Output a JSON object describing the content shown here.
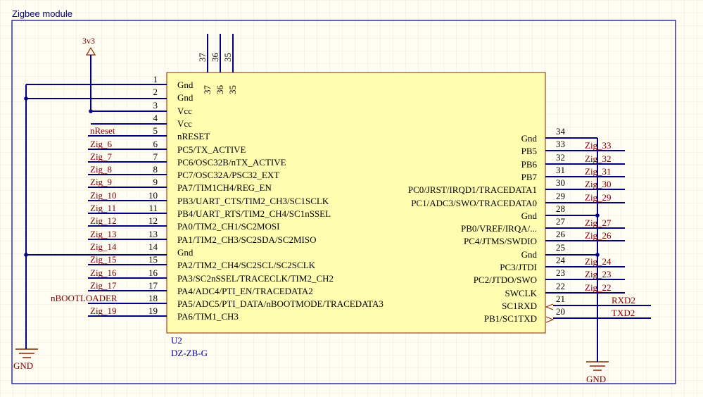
{
  "sheet": {
    "title": "Zigbee module",
    "colors": {
      "background": "#fffcf2",
      "grid": "#ebe8df",
      "border": "#000080",
      "wire": "#000080",
      "body_fill": "#fffeb0",
      "body_stroke": "#8b2500",
      "net_label": "#800000",
      "pin_text": "#000000",
      "designator": "#0000a0"
    }
  },
  "power": {
    "vcc_label": "3v3",
    "gnd_left_label": "GND",
    "gnd_right_label": "GND"
  },
  "component": {
    "designator": "U2",
    "part": "DZ-ZB-G",
    "top_pins": [
      {
        "number": "37",
        "name": "37"
      },
      {
        "number": "36",
        "name": "36"
      },
      {
        "number": "35",
        "name": "35"
      }
    ],
    "left_pins": [
      {
        "number": "1",
        "name": "Gnd",
        "net": ""
      },
      {
        "number": "2",
        "name": "Gnd",
        "net": ""
      },
      {
        "number": "3",
        "name": "Vcc",
        "net": ""
      },
      {
        "number": "4",
        "name": "Vcc",
        "net": ""
      },
      {
        "number": "5",
        "name": "nRESET",
        "net": "nReset"
      },
      {
        "number": "6",
        "name": "PC5/TX_ACTIVE",
        "net": "Zig_6"
      },
      {
        "number": "7",
        "name": "PC6/OSC32B/nTX_ACTIVE",
        "net": "Zig_7"
      },
      {
        "number": "8",
        "name": "PC7/OSC32A/PSC32_EXT",
        "net": "Zig_8"
      },
      {
        "number": "9",
        "name": "PA7/TIM1CH4/REG_EN",
        "net": "Zig_9"
      },
      {
        "number": "10",
        "name": "PB3/UART_CTS/TIM2_CH3/SC1SCLK",
        "net": "Zig_10"
      },
      {
        "number": "11",
        "name": "PB4/UART_RTS/TIM2_CH4/SC1nSSEL",
        "net": "Zig_11"
      },
      {
        "number": "12",
        "name": "PA0/TIM2_CH1/SC2MOSI",
        "net": "Zig_12"
      },
      {
        "number": "13",
        "name": "PA1/TIM2_CH3/SC2SDA/SC2MISO",
        "net": "Zig_13"
      },
      {
        "number": "14",
        "name": "Gnd",
        "net": "Zig_14"
      },
      {
        "number": "15",
        "name": "PA2/TIM2_CH4/SC2SCL/SC2SCLK",
        "net": "Zig_15"
      },
      {
        "number": "16",
        "name": "PA3/SC2nSSEL/TRACECLK/TIM2_CH2",
        "net": "Zig_16"
      },
      {
        "number": "17",
        "name": "PA4/ADC4/PTI_EN/TRACEDATA2",
        "net": "Zig_17"
      },
      {
        "number": "18",
        "name": "PA5/ADC5/PTI_DATA/nBOOTMODE/TRACEDATA3",
        "net": "nBOOTLOADER"
      },
      {
        "number": "19",
        "name": "PA6/TIM1_CH3",
        "net": "Zig_19"
      }
    ],
    "right_pins": [
      {
        "number": "34",
        "name": "Gnd",
        "net": ""
      },
      {
        "number": "33",
        "name": "PB5",
        "net": "Zig_33"
      },
      {
        "number": "32",
        "name": "PB6",
        "net": "Zig_32"
      },
      {
        "number": "31",
        "name": "PB7",
        "net": "Zig_31"
      },
      {
        "number": "30",
        "name": "PC0/JRST/IRQD1/TRACEDATA1",
        "net": "Zig_30"
      },
      {
        "number": "29",
        "name": "PC1/ADC3/SWO/TRACEDATA0",
        "net": "Zig_29"
      },
      {
        "number": "28",
        "name": "Gnd",
        "net": ""
      },
      {
        "number": "27",
        "name": "PB0/VREF/IRQA/...",
        "net": "Zig_27"
      },
      {
        "number": "26",
        "name": "PC4/JTMS/SWDIO",
        "net": "Zig_26"
      },
      {
        "number": "25",
        "name": "Gnd",
        "net": ""
      },
      {
        "number": "24",
        "name": "PC3/JTDI",
        "net": "Zig_24"
      },
      {
        "number": "23",
        "name": "PC2/JTDO/SWO",
        "net": "Zig_23"
      },
      {
        "number": "22",
        "name": "SWCLK",
        "net": "Zig_22"
      },
      {
        "number": "21",
        "name": "SC1RXD",
        "net": "RXD2"
      },
      {
        "number": "20",
        "name": "PB1/SC1TXD",
        "net": "TXD2"
      }
    ]
  }
}
